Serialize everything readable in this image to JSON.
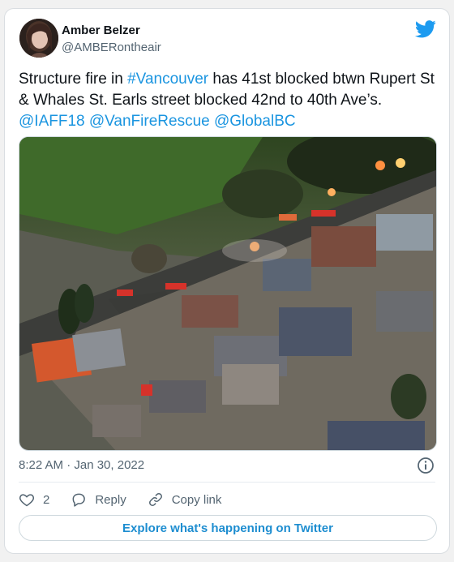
{
  "author": {
    "name": "Amber Belzer",
    "handle": "@AMBERontheair"
  },
  "tweet": {
    "text_1": "Structure fire in ",
    "hashtag": "#Vancouver",
    "text_2": " has 41st blocked btwn Rupert St & Whales St. Earls street blocked 42nd to 40th Ave’s.",
    "mention_1": "@IAFF18",
    "mention_2": "@VanFireRescue",
    "mention_3": "@GlobalBC"
  },
  "meta": {
    "timestamp": "8:22 AM · Jan 30, 2022"
  },
  "actions": {
    "like_count": "2",
    "reply_label": "Reply",
    "copy_link_label": "Copy link"
  },
  "explore_label": "Explore what's happening on Twitter",
  "colors": {
    "accent": "#1b95e0",
    "text": "#0f1419",
    "secondary": "#536471"
  },
  "icons": {
    "brand": "twitter-bird-icon",
    "info": "info-icon",
    "like": "heart-icon",
    "reply": "speech-bubble-icon",
    "copy_link": "link-icon"
  }
}
